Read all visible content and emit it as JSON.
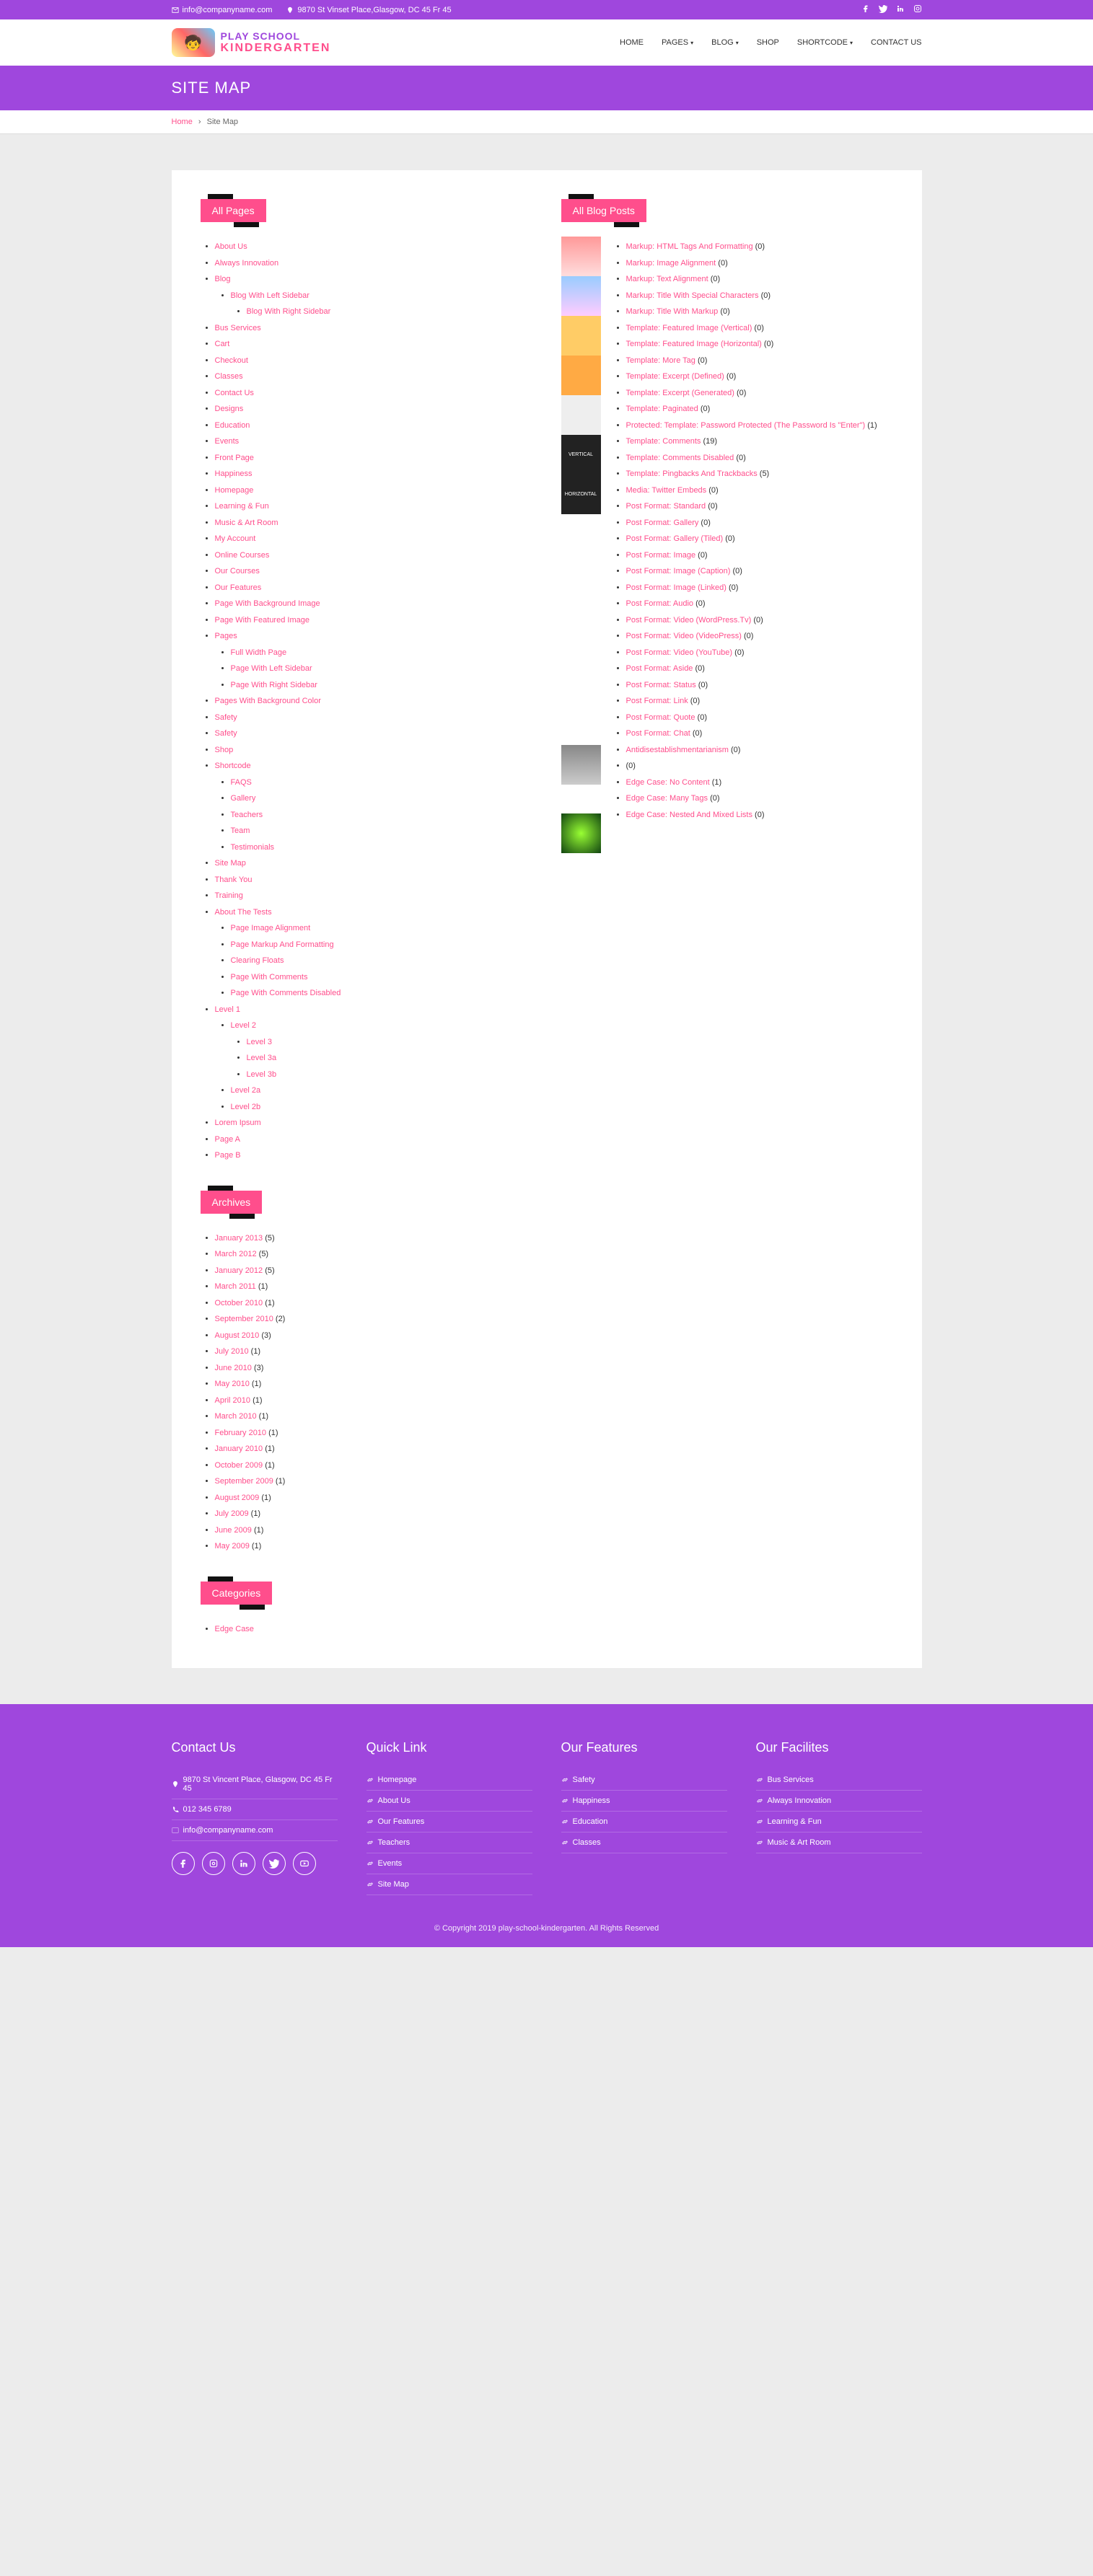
{
  "topbar": {
    "email": "info@companyname.com",
    "address": "9870 St Vinset Place,Glasgow, DC 45 Fr 45"
  },
  "logo": {
    "line1": "PLAY SCHOOL",
    "line2": "KINDERGARTEN"
  },
  "nav": {
    "home": "HOME",
    "pages": "PAGES",
    "blog": "BLOG",
    "shop": "SHOP",
    "shortcode": "SHORTCODE",
    "contact": "CONTACT US"
  },
  "page_title": "SITE MAP",
  "breadcrumb": {
    "home": "Home",
    "current": "Site Map"
  },
  "sections": {
    "all_pages": "All Pages",
    "all_blog": "All Blog Posts",
    "archives": "Archives",
    "categories": "Categories"
  },
  "pages": [
    {
      "label": "About Us"
    },
    {
      "label": "Always Innovation"
    },
    {
      "label": "Blog",
      "children": [
        {
          "label": "Blog With Left Sidebar",
          "children": [
            {
              "label": "Blog With Right Sidebar"
            }
          ]
        }
      ]
    },
    {
      "label": "Bus Services"
    },
    {
      "label": "Cart"
    },
    {
      "label": "Checkout"
    },
    {
      "label": "Classes"
    },
    {
      "label": "Contact Us"
    },
    {
      "label": "Designs"
    },
    {
      "label": "Education"
    },
    {
      "label": "Events"
    },
    {
      "label": "Front Page"
    },
    {
      "label": "Happiness"
    },
    {
      "label": "Homepage"
    },
    {
      "label": "Learning & Fun"
    },
    {
      "label": "Music & Art Room"
    },
    {
      "label": "My Account"
    },
    {
      "label": "Online Courses"
    },
    {
      "label": "Our Courses"
    },
    {
      "label": "Our Features"
    },
    {
      "label": "Page With Background Image"
    },
    {
      "label": "Page With Featured Image"
    },
    {
      "label": "Pages",
      "children": [
        {
          "label": "Full Width Page"
        },
        {
          "label": "Page With Left Sidebar"
        },
        {
          "label": "Page With Right Sidebar"
        }
      ]
    },
    {
      "label": "Pages With Background Color"
    },
    {
      "label": "Safety"
    },
    {
      "label": "Safety"
    },
    {
      "label": "Shop"
    },
    {
      "label": "Shortcode",
      "children": [
        {
          "label": "FAQS"
        },
        {
          "label": "Gallery"
        },
        {
          "label": "Teachers"
        },
        {
          "label": "Team"
        },
        {
          "label": "Testimonials"
        }
      ]
    },
    {
      "label": "Site Map"
    },
    {
      "label": "Thank You"
    },
    {
      "label": "Training"
    },
    {
      "label": "About The Tests",
      "children": [
        {
          "label": "Page Image Alignment"
        },
        {
          "label": "Page Markup And Formatting"
        },
        {
          "label": "Clearing Floats"
        },
        {
          "label": "Page With Comments"
        },
        {
          "label": "Page With Comments Disabled"
        }
      ]
    },
    {
      "label": "Level 1",
      "children": [
        {
          "label": "Level 2",
          "children": [
            {
              "label": "Level 3"
            },
            {
              "label": "Level 3a"
            },
            {
              "label": "Level 3b"
            }
          ]
        },
        {
          "label": "Level 2a"
        },
        {
          "label": "Level 2b"
        }
      ]
    },
    {
      "label": "Lorem Ipsum"
    },
    {
      "label": "Page A"
    },
    {
      "label": "Page B"
    }
  ],
  "blog_posts": [
    {
      "label": "Markup: HTML Tags And Formatting",
      "count": "(0)"
    },
    {
      "label": "Markup: Image Alignment",
      "count": "(0)"
    },
    {
      "label": "Markup: Text Alignment",
      "count": "(0)"
    },
    {
      "label": "Markup: Title With Special Characters",
      "count": "(0)"
    },
    {
      "label": "Markup: Title With Markup",
      "count": "(0)"
    },
    {
      "label": "Template: Featured Image (Vertical)",
      "count": "(0)"
    },
    {
      "label": "Template: Featured Image (Horizontal)",
      "count": "(0)"
    },
    {
      "label": "Template: More Tag",
      "count": "(0)"
    },
    {
      "label": "Template: Excerpt (Defined)",
      "count": "(0)"
    },
    {
      "label": "Template: Excerpt (Generated)",
      "count": "(0)"
    },
    {
      "label": "Template: Paginated",
      "count": "(0)"
    },
    {
      "label": "Protected: Template: Password Protected (The Password Is \"Enter\")",
      "count": "(1)"
    },
    {
      "label": "Template: Comments",
      "count": "(19)"
    },
    {
      "label": "Template: Comments Disabled",
      "count": "(0)"
    },
    {
      "label": "Template: Pingbacks And Trackbacks",
      "count": "(5)"
    },
    {
      "label": "Media: Twitter Embeds",
      "count": "(0)"
    },
    {
      "label": "Post Format: Standard",
      "count": "(0)"
    },
    {
      "label": "Post Format: Gallery",
      "count": "(0)"
    },
    {
      "label": "Post Format: Gallery (Tiled)",
      "count": "(0)"
    },
    {
      "label": "Post Format: Image",
      "count": "(0)"
    },
    {
      "label": "Post Format: Image (Caption)",
      "count": "(0)"
    },
    {
      "label": "Post Format: Image (Linked)",
      "count": "(0)"
    },
    {
      "label": "Post Format: Audio",
      "count": "(0)"
    },
    {
      "label": "Post Format: Video (WordPress.Tv)",
      "count": "(0)"
    },
    {
      "label": "Post Format: Video (VideoPress)",
      "count": "(0)"
    },
    {
      "label": "Post Format: Video (YouTube)",
      "count": "(0)"
    },
    {
      "label": "Post Format: Aside",
      "count": "(0)"
    },
    {
      "label": "Post Format: Status",
      "count": "(0)"
    },
    {
      "label": "Post Format: Link",
      "count": "(0)"
    },
    {
      "label": "Post Format: Quote",
      "count": "(0)"
    },
    {
      "label": "Post Format: Chat",
      "count": "(0)"
    },
    {
      "label": "Antidisestablishmentarianism",
      "count": "(0)"
    },
    {
      "label": "",
      "count": "(0)"
    },
    {
      "label": "Edge Case: No Content",
      "count": "(1)"
    },
    {
      "label": "Edge Case: Many Tags",
      "count": "(0)"
    },
    {
      "label": "Edge Case: Nested And Mixed Lists",
      "count": "(0)"
    }
  ],
  "archives": [
    {
      "label": "January 2013",
      "count": "(5)"
    },
    {
      "label": "March 2012",
      "count": "(5)"
    },
    {
      "label": "January 2012",
      "count": "(5)"
    },
    {
      "label": "March 2011",
      "count": "(1)"
    },
    {
      "label": "October 2010",
      "count": "(1)"
    },
    {
      "label": "September 2010",
      "count": "(2)"
    },
    {
      "label": "August 2010",
      "count": "(3)"
    },
    {
      "label": "July 2010",
      "count": "(1)"
    },
    {
      "label": "June 2010",
      "count": "(3)"
    },
    {
      "label": "May 2010",
      "count": "(1)"
    },
    {
      "label": "April 2010",
      "count": "(1)"
    },
    {
      "label": "March 2010",
      "count": "(1)"
    },
    {
      "label": "February 2010",
      "count": "(1)"
    },
    {
      "label": "January 2010",
      "count": "(1)"
    },
    {
      "label": "October 2009",
      "count": "(1)"
    },
    {
      "label": "September 2009",
      "count": "(1)"
    },
    {
      "label": "August 2009",
      "count": "(1)"
    },
    {
      "label": "July 2009",
      "count": "(1)"
    },
    {
      "label": "June 2009",
      "count": "(1)"
    },
    {
      "label": "May 2009",
      "count": "(1)"
    }
  ],
  "categories": [
    {
      "label": "Edge Case"
    }
  ],
  "thumbs": {
    "vertical": "VERTICAL",
    "horizontal": "HORIZONTAL"
  },
  "footer": {
    "contact_title": "Contact Us",
    "address": "9870 St Vincent Place, Glasgow, DC 45 Fr 45",
    "phone": "012 345 6789",
    "email": "info@companyname.com",
    "quick_title": "Quick Link",
    "quick_links": [
      "Homepage",
      "About Us",
      "Our Features",
      "Teachers",
      "Events",
      "Site Map"
    ],
    "features_title": "Our Features",
    "features": [
      "Safety",
      "Happiness",
      "Education",
      "Classes"
    ],
    "facilities_title": "Our Facilites",
    "facilities": [
      "Bus Services",
      "Always Innovation",
      "Learning & Fun",
      "Music & Art Room"
    ],
    "copyright": "© Copyright 2019 play-school-kindergarten. All Rights Reserved"
  }
}
